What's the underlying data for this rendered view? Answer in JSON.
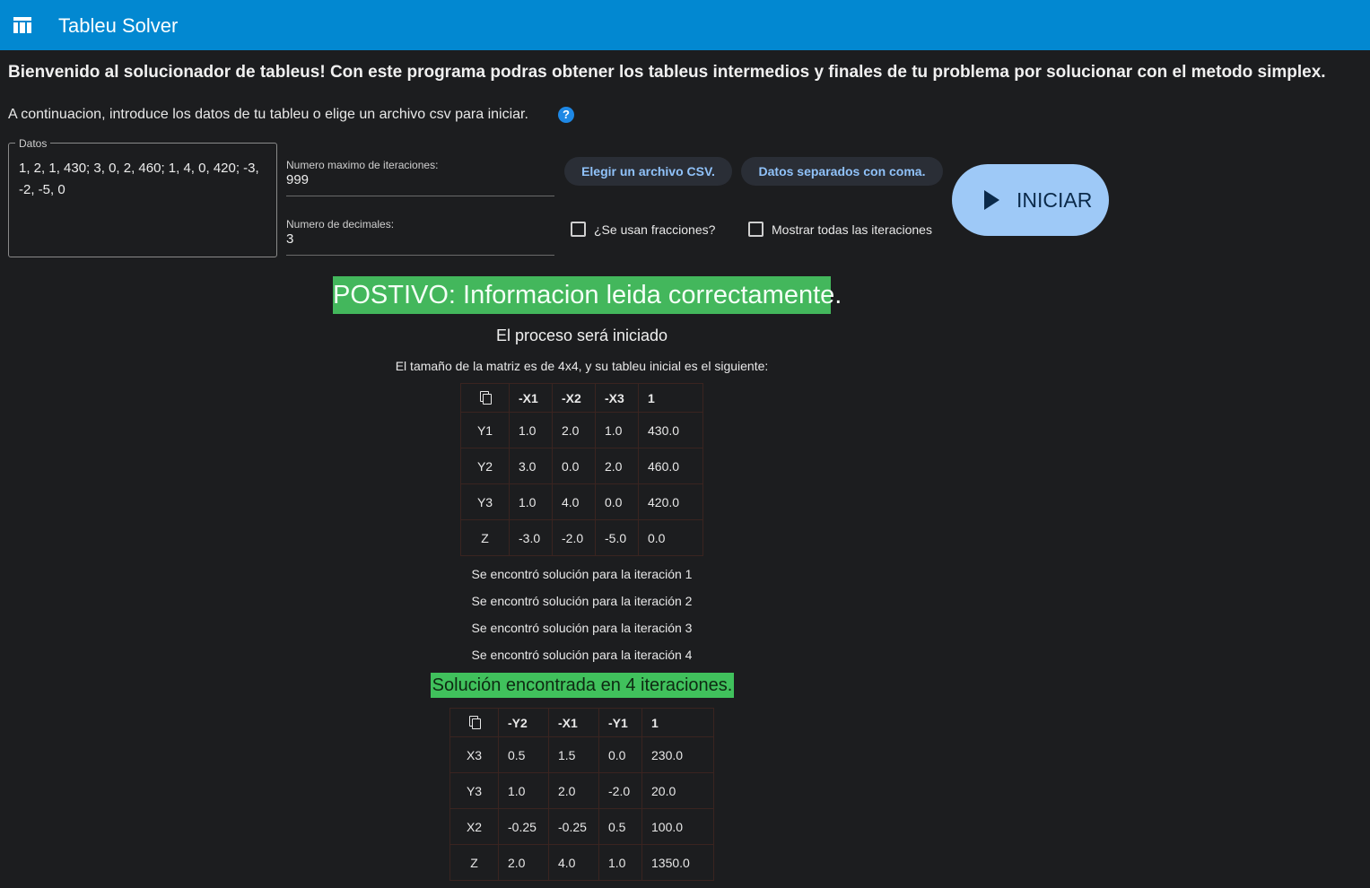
{
  "app": {
    "title": "Tableu Solver",
    "menu_icon": "table-icon"
  },
  "welcome": "Bienvenido al solucionador de tableus! Con este programa podras obtener los tableus intermedios y finales de tu problema por solucionar con el metodo simplex.",
  "intro": "A continuacion, introduce los datos de tu tableu o elige un archivo csv para iniciar.",
  "help_icon": "?",
  "datos": {
    "label": "Datos",
    "value": "1, 2, 1, 430; 3, 0, 2, 460; 1, 4, 0, 420; -3, -2, -5, 0"
  },
  "iterations_field": {
    "label": "Numero maximo de iteraciones:",
    "value": "999"
  },
  "decimals_field": {
    "label": "Numero de decimales:",
    "value": "3"
  },
  "buttons": {
    "csv": "Elegir un archivo CSV.",
    "comma": "Datos separados con coma.",
    "start": "INICIAR"
  },
  "checkboxes": {
    "fractions": "¿Se usan fracciones?",
    "show_all": "Mostrar todas las iteraciones"
  },
  "status": {
    "ok_banner": "POSTIVO: Informacion leida correctamente.",
    "process": "El proceso será iniciado",
    "matrix_desc": "El tamaño de la matriz es de 4x4, y su tableu inicial es el siguiente:",
    "solution_banner": "Solución encontrada en 4 iteraciones."
  },
  "initial_tableau": {
    "headers": [
      "-X1",
      "-X2",
      "-X3",
      "1"
    ],
    "rows": [
      [
        "Y1",
        "1.0",
        "2.0",
        "1.0",
        "430.0"
      ],
      [
        "Y2",
        "3.0",
        "0.0",
        "2.0",
        "460.0"
      ],
      [
        "Y3",
        "1.0",
        "4.0",
        "0.0",
        "420.0"
      ],
      [
        "Z",
        "-3.0",
        "-2.0",
        "-5.0",
        "0.0"
      ]
    ]
  },
  "iterations": [
    "Se encontró solución para la iteración 1",
    "Se encontró solución para la iteración 2",
    "Se encontró solución para la iteración 3",
    "Se encontró solución para la iteración 4"
  ],
  "final_tableau": {
    "headers": [
      "-Y2",
      "-X1",
      "-Y1",
      "1"
    ],
    "rows": [
      [
        "X3",
        "0.5",
        "1.5",
        "0.0",
        "230.0"
      ],
      [
        "Y3",
        "1.0",
        "2.0",
        "-2.0",
        "20.0"
      ],
      [
        "X2",
        "-0.25",
        "-0.25",
        "0.5",
        "100.0"
      ],
      [
        "Z",
        "2.0",
        "4.0",
        "1.0",
        "1350.0"
      ]
    ]
  }
}
